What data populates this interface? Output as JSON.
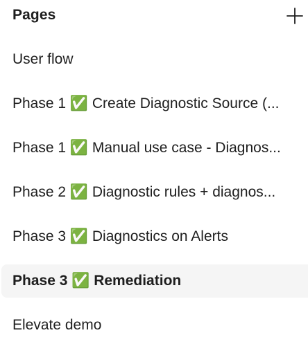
{
  "panel": {
    "title": "Pages",
    "add_button_icon": "plus-icon"
  },
  "pages": [
    {
      "label": "User flow",
      "selected": false
    },
    {
      "label": "Phase 1 ✅ Create Diagnostic Source (...",
      "selected": false
    },
    {
      "label": "Phase 1 ✅ Manual use case - Diagnos...",
      "selected": false
    },
    {
      "label": "Phase 2 ✅ Diagnostic rules + diagnos...",
      "selected": false
    },
    {
      "label": "Phase 3 ✅ Diagnostics on Alerts",
      "selected": false
    },
    {
      "label": "Phase 3 ✅ Remediation",
      "selected": true
    },
    {
      "label": "Elevate demo",
      "selected": false
    }
  ],
  "colors": {
    "text": "#1e1e1e",
    "selected_background": "#f5f5f5",
    "background": "#ffffff"
  }
}
